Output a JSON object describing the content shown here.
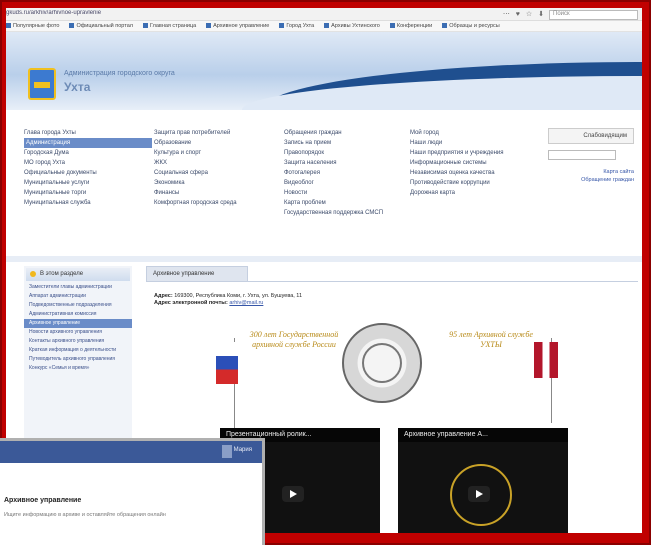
{
  "browser": {
    "url": "gkuds.ru/arkhiv/arhivnoe-upravlenie",
    "toolbar_icons": "⋯ ♥ ☆ ⬇",
    "search_placeholder": "Поиск",
    "bookmarks": [
      "Популярные фото",
      "Официальный портал",
      "Главная страница",
      "Архивное управление",
      "Город Ухта",
      "Архивы Ухтинского",
      "Конференции",
      "Образцы и ресурсы"
    ]
  },
  "site": {
    "header_line1": "Администрация городского округа",
    "header_line2": "Ухта"
  },
  "nav": {
    "columns": [
      [
        {
          "label": "Глава города Ухты",
          "active": false
        },
        {
          "label": "Администрация",
          "active": true
        },
        {
          "label": "Городская Дума",
          "active": false
        },
        {
          "label": "МО город Ухта",
          "active": false
        },
        {
          "label": "Официальные документы",
          "active": false
        },
        {
          "label": "Муниципальные услуги",
          "active": false
        },
        {
          "label": "Муниципальные торги",
          "active": false
        },
        {
          "label": "Муниципальная служба",
          "active": false
        }
      ],
      [
        {
          "label": "Защита прав потребителей",
          "active": false
        },
        {
          "label": "Образование",
          "active": false
        },
        {
          "label": "Культура и спорт",
          "active": false
        },
        {
          "label": "ЖКХ",
          "active": false
        },
        {
          "label": "Социальная сфера",
          "active": false
        },
        {
          "label": "Экономика",
          "active": false
        },
        {
          "label": "Финансы",
          "active": false
        },
        {
          "label": "Комфортная городская среда",
          "active": false
        }
      ],
      [
        {
          "label": "Обращения граждан",
          "active": false
        },
        {
          "label": "Запись на прием",
          "active": false
        },
        {
          "label": "Правопорядок",
          "active": false
        },
        {
          "label": "Защита населения",
          "active": false
        },
        {
          "label": "Фотогалерея",
          "active": false
        },
        {
          "label": "Видеоблог",
          "active": false
        },
        {
          "label": "Новости",
          "active": false
        },
        {
          "label": "Карта проблем",
          "active": false
        },
        {
          "label": "Государственная поддержка СМСП",
          "active": false
        }
      ],
      [
        {
          "label": "Мой город",
          "active": false
        },
        {
          "label": "Наши люди",
          "active": false
        },
        {
          "label": "Наши предприятия и учреждения",
          "active": false
        },
        {
          "label": "Информационные системы",
          "active": false
        },
        {
          "label": "Независимая оценка качества",
          "active": false
        },
        {
          "label": "Противодействие коррупции",
          "active": false
        },
        {
          "label": "Дорожная карта",
          "active": false
        }
      ]
    ],
    "sidebox": {
      "button_label": "Слабовидящим",
      "links": [
        "Карта сайта",
        "Обращение граждан"
      ]
    }
  },
  "left_panel": {
    "title": "В этом разделе",
    "items": [
      {
        "label": "Заместители главы администрации",
        "active": false
      },
      {
        "label": "Аппарат администрации",
        "active": false
      },
      {
        "label": "Подведомственные подразделения",
        "active": false
      },
      {
        "label": "Административная комиссия",
        "active": false
      },
      {
        "label": "Архивное управление",
        "active": true
      },
      {
        "label": "Новости архивного управления",
        "active": false
      },
      {
        "label": "Контакты архивного управления",
        "active": false
      },
      {
        "label": "Краткая информация о деятельности",
        "active": false
      },
      {
        "label": "Путеводитель архивного управления",
        "active": false
      },
      {
        "label": "Конкурс «Семья и время»",
        "active": false
      }
    ]
  },
  "content": {
    "tab_label": "Архивное управление",
    "address_label": "Адрес:",
    "address": "169300, Республика Коми, г. Ухта, ул. Бушуева, 11",
    "email_label": "Адрес электронной почты:",
    "email": "arhiv@mail.ru",
    "left_caption": "300 лет Государственной архивной службе России",
    "right_caption": "95 лет Архивной службе УХТЫ"
  },
  "videos": [
    {
      "title": "Презентационный ролик..."
    },
    {
      "title": "Архивное управление А..."
    }
  ],
  "overlay": {
    "user_label": "Мария",
    "heading": "Архивное управление",
    "text": "Ищите информацию в архиве и оставляйте обращения онлайн"
  },
  "colors": {
    "frame": "#c00000",
    "banner_wave": "#1f4f8f",
    "nav_active": "#6a8cc8",
    "facebook_blue": "#3b5998"
  }
}
